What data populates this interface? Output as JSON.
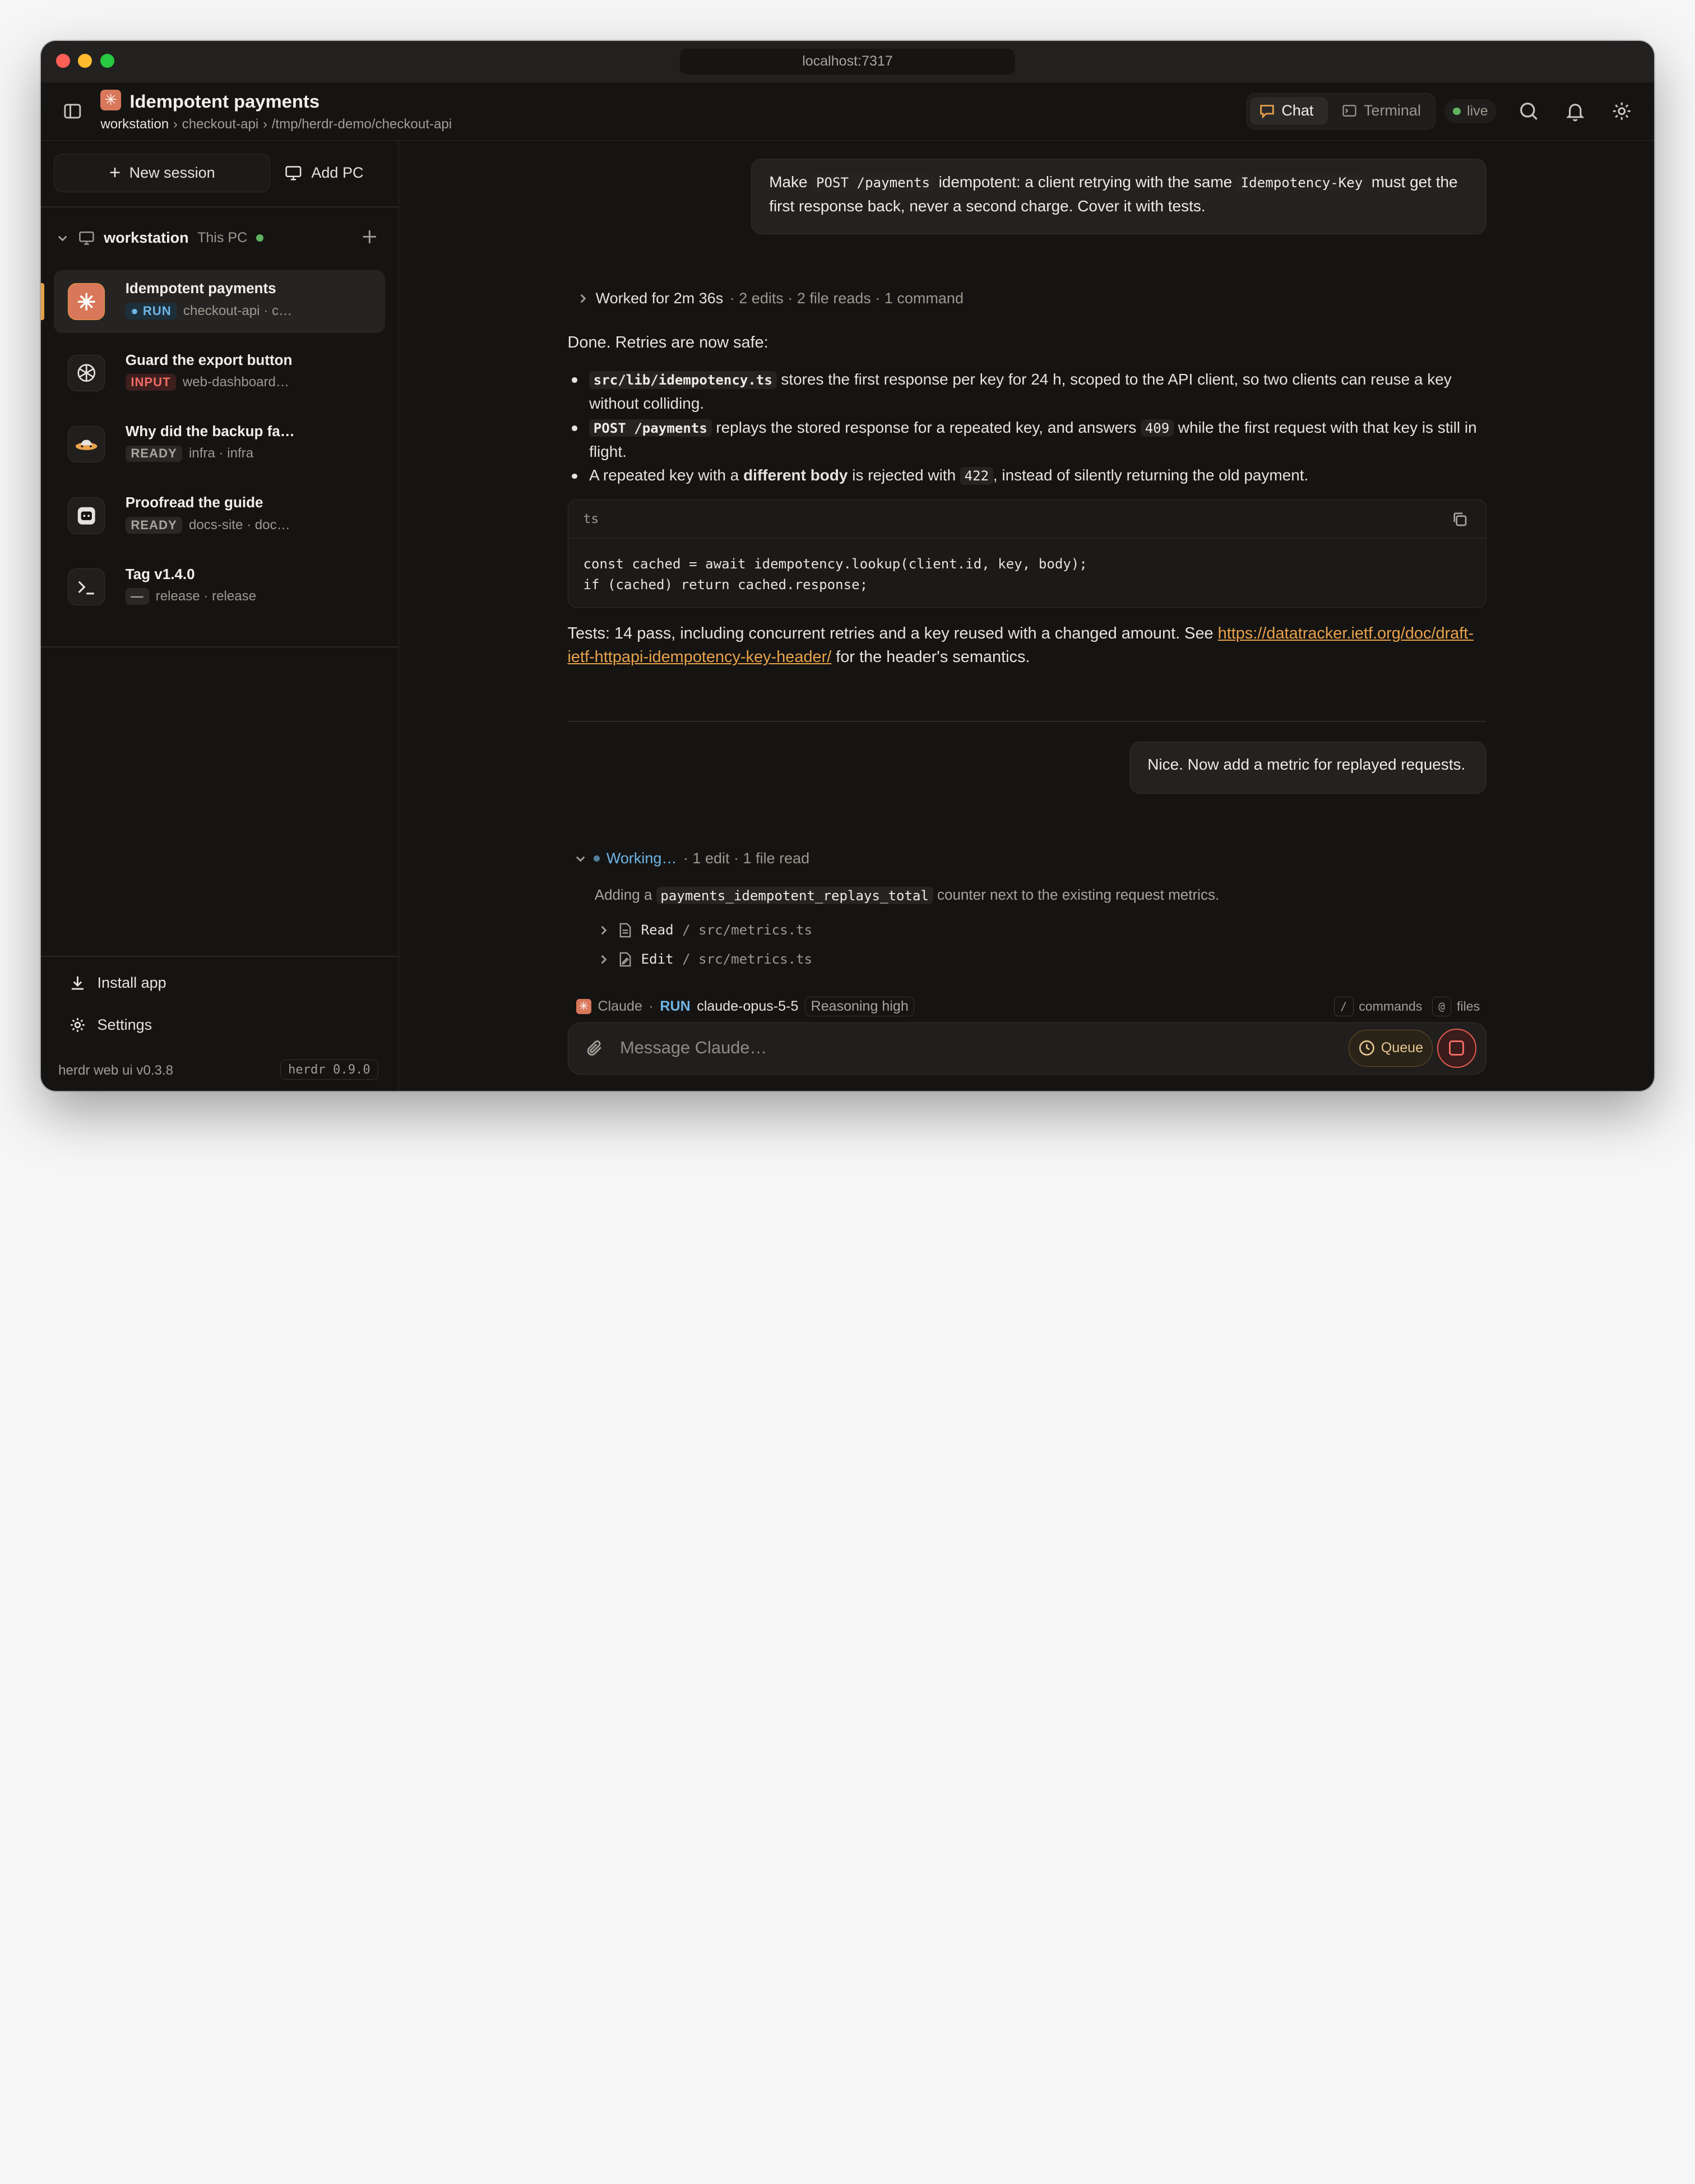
{
  "window": {
    "url": "localhost:7317"
  },
  "header": {
    "title": "Idempotent payments",
    "breadcrumb": [
      "workstation",
      "›",
      "checkout-api",
      "›",
      "/tmp/herdr-demo/checkout-api"
    ],
    "tabs": {
      "chat": "Chat",
      "terminal": "Terminal"
    },
    "status": "live"
  },
  "sidebar": {
    "new_session": "New session",
    "add_pc": "Add PC",
    "workstation": {
      "name": "workstation",
      "sub": "This PC"
    },
    "sessions": [
      {
        "title": "Idempotent payments",
        "status": "RUN",
        "meta": "checkout-api · c…",
        "icon": "claude-icon"
      },
      {
        "title": "Guard the export button",
        "status": "INPUT",
        "meta": "web-dashboard…",
        "icon": "openai-icon"
      },
      {
        "title": "Why did the backup fa…",
        "status": "READY",
        "meta": "infra · infra",
        "icon": "ufo-icon"
      },
      {
        "title": "Proofread the guide",
        "status": "READY",
        "meta": "docs-site · doc…",
        "icon": "agent-face-icon"
      },
      {
        "title": "Tag v1.4.0",
        "status": "—",
        "meta": "release · release",
        "icon": "terminal-icon"
      }
    ],
    "install_app": "Install app",
    "settings": "Settings",
    "version": "herdr web ui v0.3.8",
    "herdr_version": "herdr 0.9.0"
  },
  "chat": {
    "user_msg_1": {
      "t1": "Make ",
      "c1": "POST /payments",
      "t2": " idempotent: a client retrying with the same ",
      "c2": "Idempotency-Key",
      "t3": " must get the first response back, never a second charge. Cover it with tests."
    },
    "worked": {
      "label": "Worked for 2m 36s",
      "detail": "· 2 edits · 2 file reads · 1 command"
    },
    "done": "Done. Retries are now safe:",
    "bullets": [
      {
        "code": "src/lib/idempotency.ts",
        "text": " stores the first response per key for 24 h, scoped to the API client, so two clients can reuse a key without colliding."
      },
      {
        "code": "POST /payments",
        "text_a": " replays the stored response for a repeated key, and answers ",
        "code2": "409",
        "text_b": " while the first request with that key is still in flight."
      },
      {
        "text_a": "A repeated key with a ",
        "bold": "different body",
        "text_b": " is rejected with ",
        "code": "422",
        "text_c": ", instead of silently returning the old payment."
      }
    ],
    "code_block": {
      "lang": "ts",
      "line1": "const cached = await idempotency.lookup(client.id, key, body);",
      "line2": "if (cached) return cached.response;"
    },
    "tests": {
      "text": "Tests: 14 pass, including concurrent retries and a key reused with a changed amount. See ",
      "link": "https://datatracker.ietf.org/doc/draft-ietf-httpapi-idempotency-key-header/",
      "tail": " for the header's semantics."
    },
    "user_msg_2": "Nice. Now add a metric for replayed requests.",
    "working": {
      "label": "Working…",
      "detail": "· 1 edit · 1 file read"
    },
    "adding": {
      "t1": "Adding a ",
      "code": "payments_idempotent_replays_total",
      "t2": " counter next to the existing request metrics."
    },
    "tools": [
      {
        "verb": "Read",
        "path": "/ src/metrics.ts"
      },
      {
        "verb": "Edit",
        "path": "/ src/metrics.ts"
      }
    ]
  },
  "composer": {
    "agent": "Claude",
    "status": "RUN",
    "model": "claude-opus-5-5",
    "reasoning": "Reasoning high",
    "hint_commands_key": "/",
    "hint_commands": "commands",
    "hint_files_key": "@",
    "hint_files": "files",
    "placeholder": "Message Claude…",
    "queue": "Queue"
  },
  "colors": {
    "accent": "#e9a24a",
    "run": "#6fb6e5",
    "input": "#ef6b63",
    "live": "#5fb35f"
  }
}
